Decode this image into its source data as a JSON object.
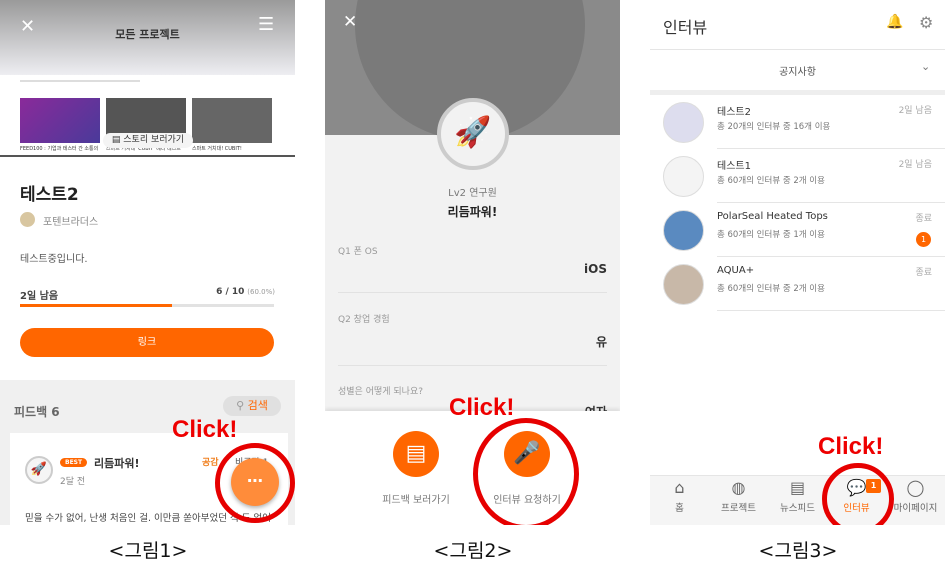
{
  "accent": "#ff6600",
  "screen1": {
    "header_title": "모든 프로젝트",
    "thumbnails": [
      "FEED100 : 기업과 테스터 간 소통의",
      "스마트 거치대 'CUBIT' 베타 테스트",
      "스마트 거치대! CUBIT!"
    ],
    "story_button": "스토리 보러가기",
    "project_title": "테스트2",
    "company": "포텐브라더스",
    "description": "테스트중입니다.",
    "days_left": "2일 남음",
    "progress_count": "6 / 10",
    "progress_percent": "(60.0%)",
    "progress_value": 0.6,
    "link_button": "링크",
    "feedback_title": "피드백 6",
    "search_button": "검색",
    "card": {
      "badge": "BEST",
      "author": "리듬파워!",
      "time": "2달 전",
      "like": "공감",
      "dislike": "비공감 1",
      "text": "믿을 수가 없어, 난생 처음인 걸. 이만큼 쏟아부었던 적 도 없어"
    }
  },
  "screen2": {
    "level": "Lv2 연구원",
    "name": "리듬파워!",
    "answers": [
      {
        "q": "Q1 폰 OS",
        "a": "iOS"
      },
      {
        "q": "Q2 창업 경험",
        "a": "유"
      },
      {
        "q": "성별은 어떻게 되나요?",
        "a": "여자"
      }
    ],
    "actions": [
      "피드백 보러가기",
      "인터뷰 요청하기"
    ]
  },
  "screen3": {
    "title": "인터뷰",
    "notice": "공지사항",
    "items": [
      {
        "title": "테스트2",
        "sub": "총 20개의 인터뷰 중 16개 이용",
        "status": "2일 남음",
        "badge": ""
      },
      {
        "title": "테스트1",
        "sub": "총 60개의 인터뷰 중 2개 이용",
        "status": "2일 남음",
        "badge": ""
      },
      {
        "title": "PolarSeal Heated Tops",
        "sub": "총 60개의 인터뷰 중 1개 이용",
        "status": "종료",
        "badge": "1"
      },
      {
        "title": "AQUA+",
        "sub": "총 60개의 인터뷰 중 2개 이용",
        "status": "종료",
        "badge": ""
      }
    ],
    "nav": [
      "홈",
      "프로젝트",
      "뉴스피드",
      "인터뷰",
      "마이페이지"
    ],
    "nav_badge": "1"
  },
  "annotation": "Click!",
  "captions": [
    "<그림1>",
    "<그림2>",
    "<그림3>"
  ]
}
